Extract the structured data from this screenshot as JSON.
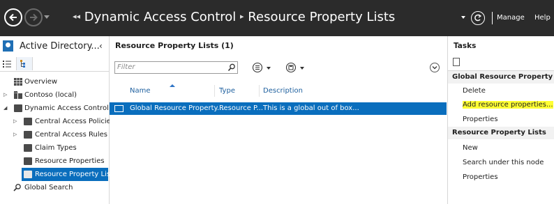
{
  "window": {
    "breadcrumb": [
      "Dynamic Access Control",
      "Resource Property Lists"
    ],
    "manage_label": "Manage",
    "help_label": "Help"
  },
  "nav": {
    "title": "Active Directory...",
    "collapse_glyph": "‹",
    "tree": [
      {
        "label": "Overview",
        "icon": "overview-icon"
      },
      {
        "label": "Contoso (local)",
        "icon": "domain-icon",
        "arrow": "▷"
      },
      {
        "label": "Dynamic Access Control",
        "icon": "folder-icon",
        "arrow": "◢"
      },
      {
        "label": "Central Access Policies",
        "icon": "folder-icon",
        "arrow": "▷"
      },
      {
        "label": "Central Access Rules",
        "icon": "folder-icon",
        "arrow": "▷"
      },
      {
        "label": "Claim Types",
        "icon": "folder-icon"
      },
      {
        "label": "Resource Properties",
        "icon": "folder-icon"
      },
      {
        "label": "Resource Property Lists",
        "icon": "folder-icon",
        "selected": true
      },
      {
        "label": "Global Search",
        "icon": "search-icon"
      }
    ]
  },
  "main": {
    "title": "Resource Property Lists  (1)",
    "filter_placeholder": "Filter",
    "columns": [
      "Name",
      "Type",
      "Description"
    ],
    "rows": [
      {
        "name": "Global Resource Property...",
        "type": "Resource P...",
        "description": "This is a global out of box..."
      }
    ]
  },
  "tasks": {
    "title": "Tasks",
    "sections": [
      {
        "label": "Global Resource Property List",
        "items": [
          "Delete",
          "Add resource properties...",
          "Properties"
        ]
      },
      {
        "label": "Resource Property Lists",
        "items": [
          "New",
          "Search under this node",
          "Properties"
        ]
      }
    ],
    "highlight_color": "#ffff33"
  },
  "colors": {
    "accent": "#0a6ebd",
    "titlebar": "#2b2b2b",
    "header_text": "#1d5f9e"
  }
}
